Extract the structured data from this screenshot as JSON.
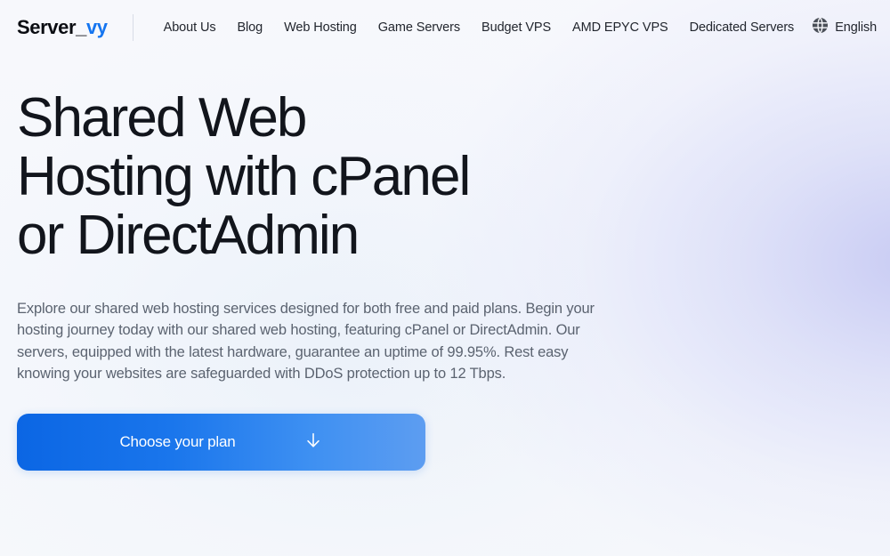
{
  "header": {
    "logo": {
      "text_primary": "Server_",
      "text_accent": "vy",
      "accent_color": "#1575f0"
    },
    "nav_items": [
      {
        "label": "About Us"
      },
      {
        "label": "Blog"
      },
      {
        "label": "Web Hosting"
      },
      {
        "label": "Game Servers"
      },
      {
        "label": "Budget VPS"
      },
      {
        "label": "AMD EPYC VPS"
      },
      {
        "label": "Dedicated Servers"
      }
    ],
    "language": {
      "icon": "globe-icon",
      "label": "English"
    }
  },
  "hero": {
    "title_line_1": "Shared Web",
    "title_line_2": "Hosting with cPanel",
    "title_line_3": "or DirectAdmin",
    "description": "Explore our shared web hosting services designed for both free and paid plans. Begin your hosting journey today with our shared web hosting, featuring cPanel or DirectAdmin. Our servers, equipped with the latest hardware, guarantee an uptime of 99.95%. Rest easy knowing your websites are safeguarded with DDoS protection up to 12 Tbps.",
    "cta": {
      "label": "Choose your plan",
      "icon": "arrow-down-icon",
      "gradient_from": "#0b66e4",
      "gradient_to": "#5d9df1"
    }
  },
  "theme": {
    "page_background": "#f7f8fc",
    "glow_color": "#c6c9f3",
    "text_primary": "#12151c",
    "text_muted": "#5b6370",
    "accent": "#1575f0"
  }
}
